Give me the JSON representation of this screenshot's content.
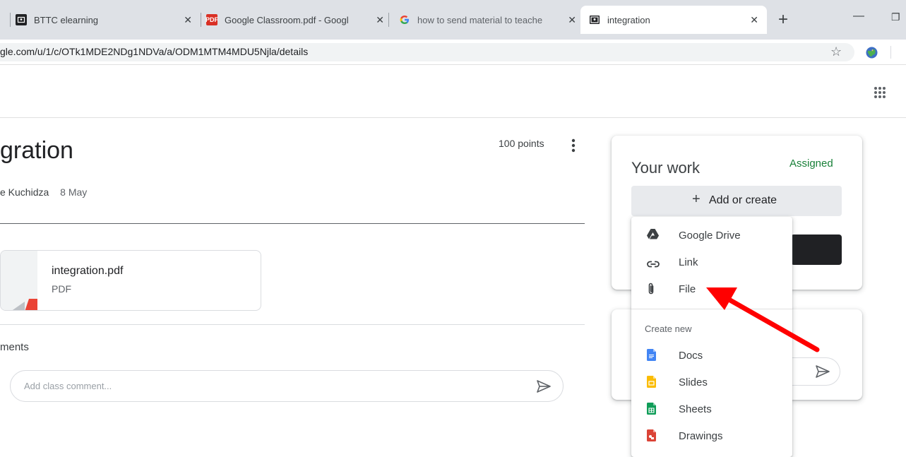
{
  "browser": {
    "tabs": [
      {
        "title": "BTTC elearning",
        "icon": "classroom-icon"
      },
      {
        "title": "Google Classroom.pdf - Googl",
        "icon": "pdf-icon"
      },
      {
        "title": "how to send material to teache",
        "icon": "google-icon"
      },
      {
        "title": "integration",
        "icon": "classroom-icon"
      }
    ],
    "new_tab": "+",
    "minimize": "—",
    "restore": "❐",
    "url": "gle.com/u/1/c/OTk1MDE2NDg1NDVa/a/ODM1MTM4MDU5Njla/details",
    "pdf_badge": "PDF"
  },
  "assignment": {
    "title": "gration",
    "author": "e Kuchidza",
    "date": "8 May",
    "points": "100 points",
    "attachment": {
      "name": "integration.pdf",
      "type": "PDF"
    },
    "comments_heading": "ments",
    "comment_placeholder": "Add class comment..."
  },
  "your_work": {
    "title": "Your work",
    "status": "Assigned",
    "add_button": "Add or create"
  },
  "add_menu": {
    "items": [
      {
        "label": "Google Drive",
        "icon": "google-drive-icon"
      },
      {
        "label": "Link",
        "icon": "link-icon"
      },
      {
        "label": "File",
        "icon": "paperclip-icon"
      }
    ],
    "create_heading": "Create new",
    "create_items": [
      {
        "label": "Docs",
        "icon": "docs-icon",
        "color": "#4285f4"
      },
      {
        "label": "Slides",
        "icon": "slides-icon",
        "color": "#fbbc04"
      },
      {
        "label": "Sheets",
        "icon": "sheets-icon",
        "color": "#0f9d58"
      },
      {
        "label": "Drawings",
        "icon": "drawings-icon",
        "color": "#db4437"
      }
    ]
  },
  "colors": {
    "assigned": "#188038",
    "annotation_arrow": "#ff0000"
  }
}
